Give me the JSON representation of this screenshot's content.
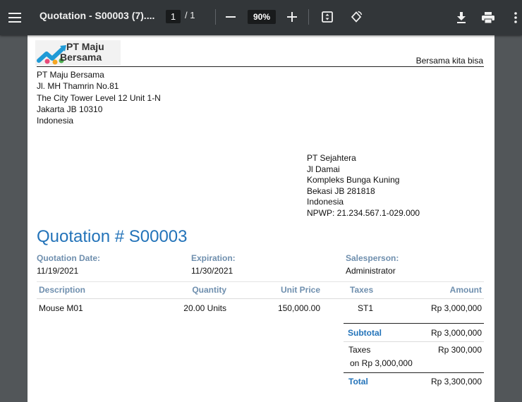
{
  "toolbar": {
    "title": "Quotation - S00003 (7)....",
    "page_current": "1",
    "page_sep": "/",
    "page_total": "1",
    "zoom": "90%"
  },
  "doc": {
    "logo_text_line1": "PT Maju",
    "logo_text_line2": "Bersama",
    "tagline": "Bersama kita bisa",
    "company_address": [
      "PT Maju Bersama",
      "Jl. MH Thamrin No.81",
      "The City Tower Level 12 Unit 1-N",
      "Jakarta JB 10310",
      "Indonesia"
    ],
    "customer_address": [
      "PT Sejahtera",
      "Jl Damai",
      "Kompleks Bunga Kuning",
      "Bekasi JB 281818",
      "Indonesia",
      "NPWP: 21.234.567.1-029.000"
    ],
    "title": "Quotation # S00003",
    "info": {
      "date_label": "Quotation Date:",
      "date_value": "11/19/2021",
      "expiration_label": "Expiration:",
      "expiration_value": "11/30/2021",
      "salesperson_label": "Salesperson:",
      "salesperson_value": "Administrator"
    },
    "table": {
      "headers": [
        "Description",
        "Quantity",
        "Unit Price",
        "Taxes",
        "Amount"
      ],
      "rows": [
        {
          "description": "Mouse M01",
          "quantity": "20.00 Units",
          "unit_price": "150,000.00",
          "taxes": "ST1",
          "amount": "Rp 3,000,000"
        }
      ]
    },
    "totals": {
      "subtotal_label": "Subtotal",
      "subtotal_value": "Rp 3,000,000",
      "taxes_label": "Taxes",
      "taxes_sub": "on Rp 3,000,000",
      "taxes_value": "Rp 300,000",
      "total_label": "Total",
      "total_value": "Rp 3,300,000"
    }
  },
  "colors": {
    "toolbar_bg": "#323639",
    "viewer_bg": "#525659",
    "accent_blue": "#2373b9",
    "label_blue_grey": "#6f8fae"
  },
  "icons": [
    "menu-icon",
    "minus-icon",
    "plus-icon",
    "fit-page-icon",
    "rotate-icon",
    "download-icon",
    "print-icon",
    "more-vert-icon"
  ]
}
